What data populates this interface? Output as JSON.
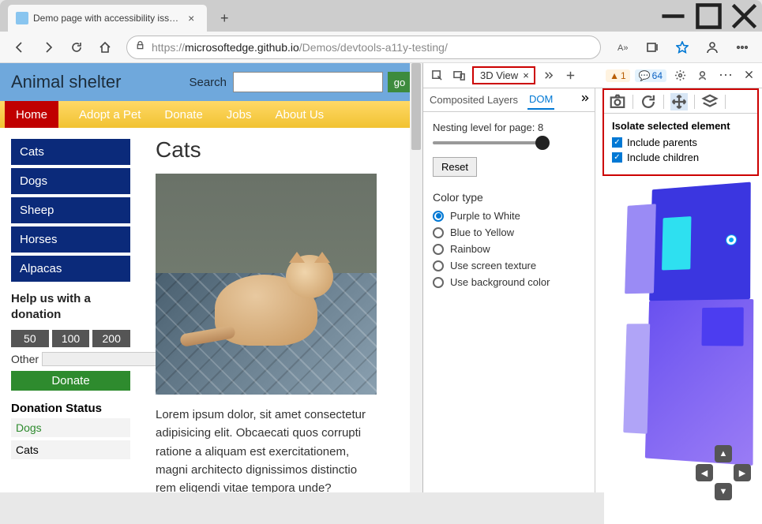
{
  "browser": {
    "tab_title": "Demo page with accessibility iss…",
    "url_gray_left": "https://",
    "url_dark": "microsoftedge.github.io",
    "url_gray_right": "/Demos/devtools-a11y-testing/"
  },
  "page": {
    "brand": "Animal shelter",
    "search_label": "Search",
    "go_label": "go",
    "nav": [
      "Home",
      "Adopt a Pet",
      "Donate",
      "Jobs",
      "About Us"
    ],
    "sidebar_cats": [
      "Cats",
      "Dogs",
      "Sheep",
      "Horses",
      "Alpacas"
    ],
    "help_header": "Help us with a donation",
    "amounts": [
      "50",
      "100",
      "200"
    ],
    "other_label": "Other",
    "donate_btn": "Donate",
    "donation_status_hdr": "Donation Status",
    "status_rows": [
      "Dogs",
      "Cats"
    ],
    "main_heading": "Cats",
    "paragraph": "Lorem ipsum dolor, sit amet consectetur adipisicing elit. Obcaecati quos corrupti ratione a aliquam est exercitationem, magni architecto dignissimos distinctio rem eligendi vitae tempora unde?"
  },
  "devtools": {
    "tab_3dview": "3D View",
    "warn_count": "1",
    "info_count": "64",
    "subtabs": {
      "composited": "Composited Layers",
      "dom": "DOM"
    },
    "nesting_label": "Nesting level for page: 8",
    "reset_label": "Reset",
    "color_type_hdr": "Color type",
    "color_options": [
      "Purple to White",
      "Blue to Yellow",
      "Rainbow",
      "Use screen texture",
      "Use background color"
    ],
    "isolate_hdr": "Isolate selected element",
    "include_parents": "Include parents",
    "include_children": "Include children"
  }
}
